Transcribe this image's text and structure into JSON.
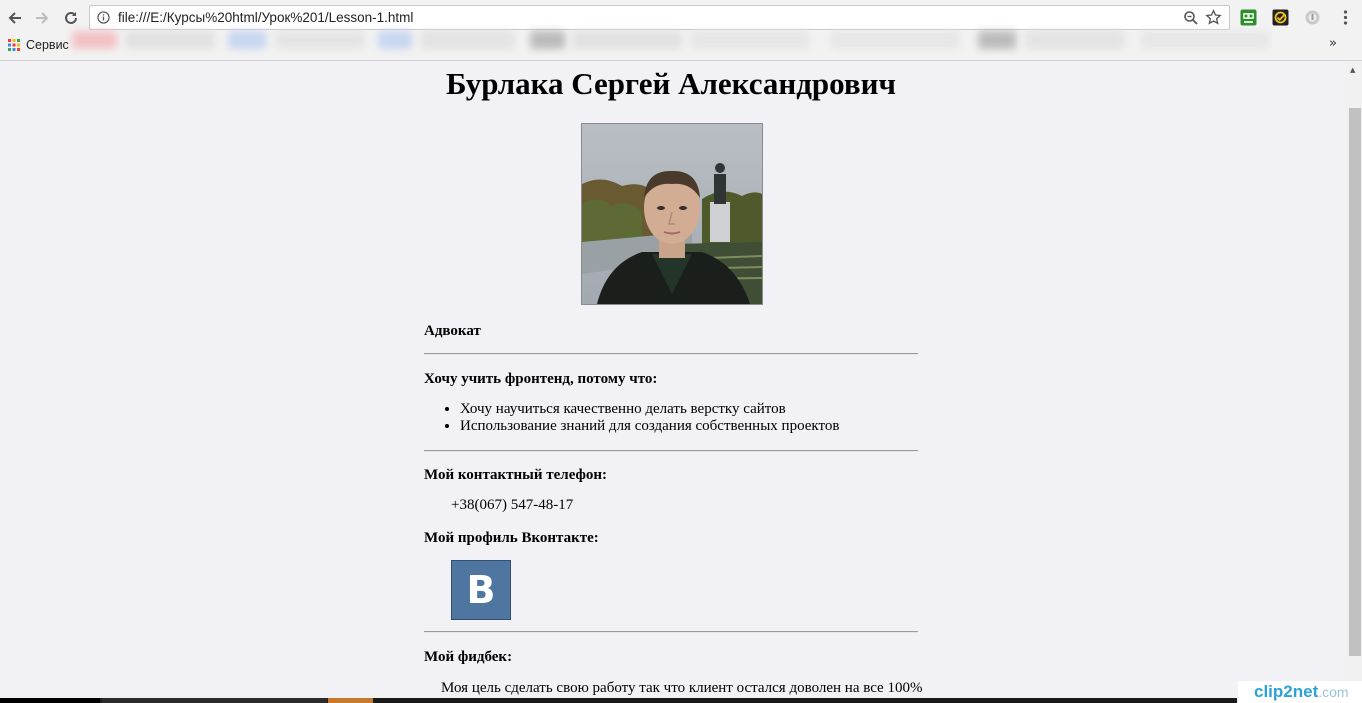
{
  "browser": {
    "url": "file:///E:/Курсы%20html/Урок%201/Lesson-1.html",
    "bookmarks_apps_label": "Сервис",
    "bookmarks_more": "»"
  },
  "page": {
    "name": "Бурлака Сергей Александрович",
    "profession": "Адвокат",
    "why_heading": "Хочу учить фронтенд, потому что:",
    "reasons": [
      "Хочу научиться качественно делать верстку сайтов",
      "Использование знаний для создания собственных проектов"
    ],
    "phone_heading": "Мой контактный телефон:",
    "phone": "+38(067) 547-48-17",
    "vk_heading": "Мой профиль Вконтакте:",
    "vk_letter": "B",
    "feedback_heading": "Мой фидбек:",
    "feedback_text": "Моя цель сделать свою работу так что клиент остался доволен на все 100%"
  },
  "watermark": {
    "brand": "clip2net",
    "domain": ".com"
  },
  "colors": {
    "page_background": "#f2f1f6",
    "vk_blue": "#4f76a1",
    "browser_chrome": "#f2f2f2"
  }
}
